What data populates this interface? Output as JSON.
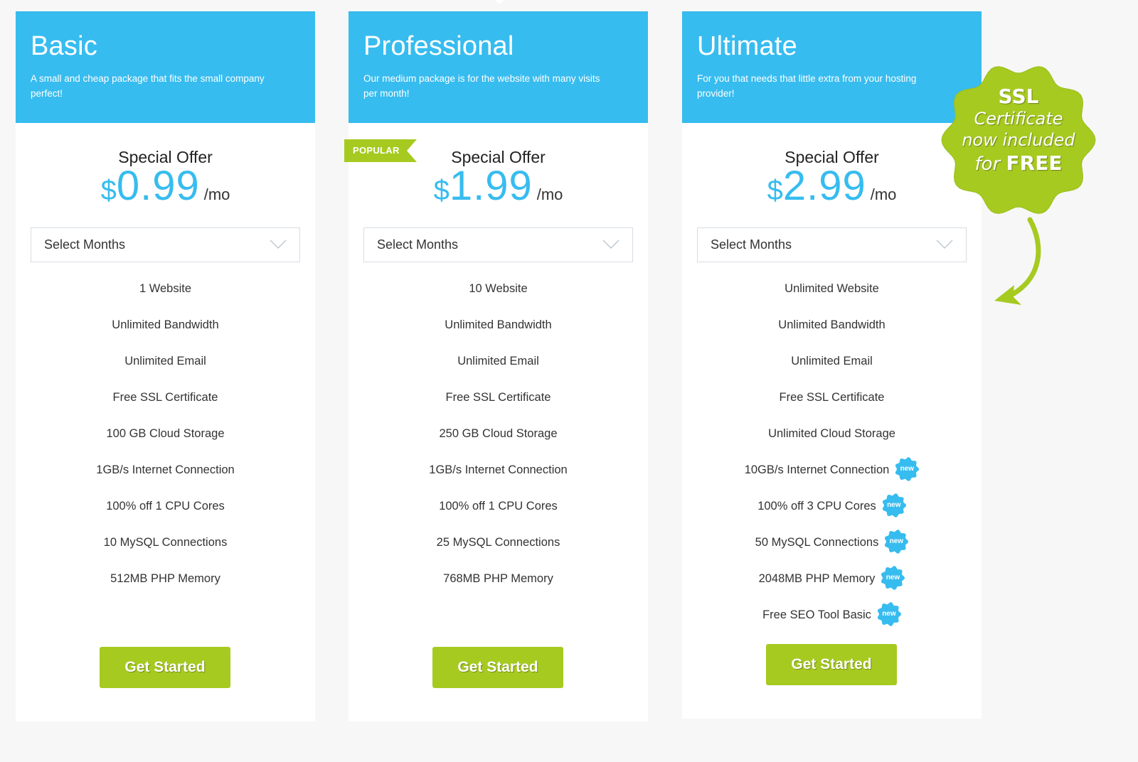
{
  "colors": {
    "accent": "#37bcef",
    "button": "#a6ca20",
    "background": "#f7f7f7"
  },
  "plans": [
    {
      "name": "Basic",
      "description": "A small and cheap package that fits the small company perfect!",
      "offer_label": "Special Offer",
      "currency": "$",
      "price": "0.99",
      "period": "/mo",
      "select": {
        "value": "Select Months"
      },
      "features": [
        {
          "text": "1 Website"
        },
        {
          "text": "Unlimited Bandwidth"
        },
        {
          "text": "Unlimited Email"
        },
        {
          "text": "Free SSL Certificate"
        },
        {
          "text": "100 GB Cloud Storage"
        },
        {
          "text": "1GB/s Internet Connection"
        },
        {
          "text": "100% off 1 CPU Cores"
        },
        {
          "text": "10 MySQL Connections"
        },
        {
          "text": "512MB PHP Memory"
        }
      ],
      "cta": "Get Started"
    },
    {
      "name": "Professional",
      "description": "Our medium package is for the website with many visits per month!",
      "ribbon": "POPULAR",
      "offer_label": "Special Offer",
      "currency": "$",
      "price": "1.99",
      "period": "/mo",
      "select": {
        "value": "Select Months"
      },
      "features": [
        {
          "text": "10 Website"
        },
        {
          "text": "Unlimited Bandwidth"
        },
        {
          "text": "Unlimited Email"
        },
        {
          "text": "Free SSL Certificate"
        },
        {
          "text": "250 GB Cloud Storage"
        },
        {
          "text": "1GB/s Internet Connection"
        },
        {
          "text": "100% off 1 CPU Cores"
        },
        {
          "text": "25 MySQL Connections"
        },
        {
          "text": "768MB PHP Memory"
        }
      ],
      "cta": "Get Started"
    },
    {
      "name": "Ultimate",
      "description": "For you that needs that little extra from your hosting provider!",
      "offer_label": "Special Offer",
      "currency": "$",
      "price": "2.99",
      "period": "/mo",
      "select": {
        "value": "Select Months"
      },
      "features": [
        {
          "text": "Unlimited Website"
        },
        {
          "text": "Unlimited Bandwidth"
        },
        {
          "text": "Unlimited Email"
        },
        {
          "text": "Free SSL Certificate"
        },
        {
          "text": "Unlimited Cloud Storage"
        },
        {
          "text": "10GB/s Internet Connection",
          "badge": "new"
        },
        {
          "text": "100% off 3 CPU Cores",
          "badge": "new"
        },
        {
          "text": "50 MySQL Connections",
          "badge": "new"
        },
        {
          "text": "2048MB PHP Memory",
          "badge": "new"
        },
        {
          "text": "Free SEO Tool Basic",
          "badge": "new"
        }
      ],
      "cta": "Get Started"
    }
  ],
  "ssl_promo": {
    "line1": "SSL",
    "line2": "Certificate",
    "line3": "now included",
    "line4_prefix": "for",
    "line4_emphasis": "FREE"
  }
}
